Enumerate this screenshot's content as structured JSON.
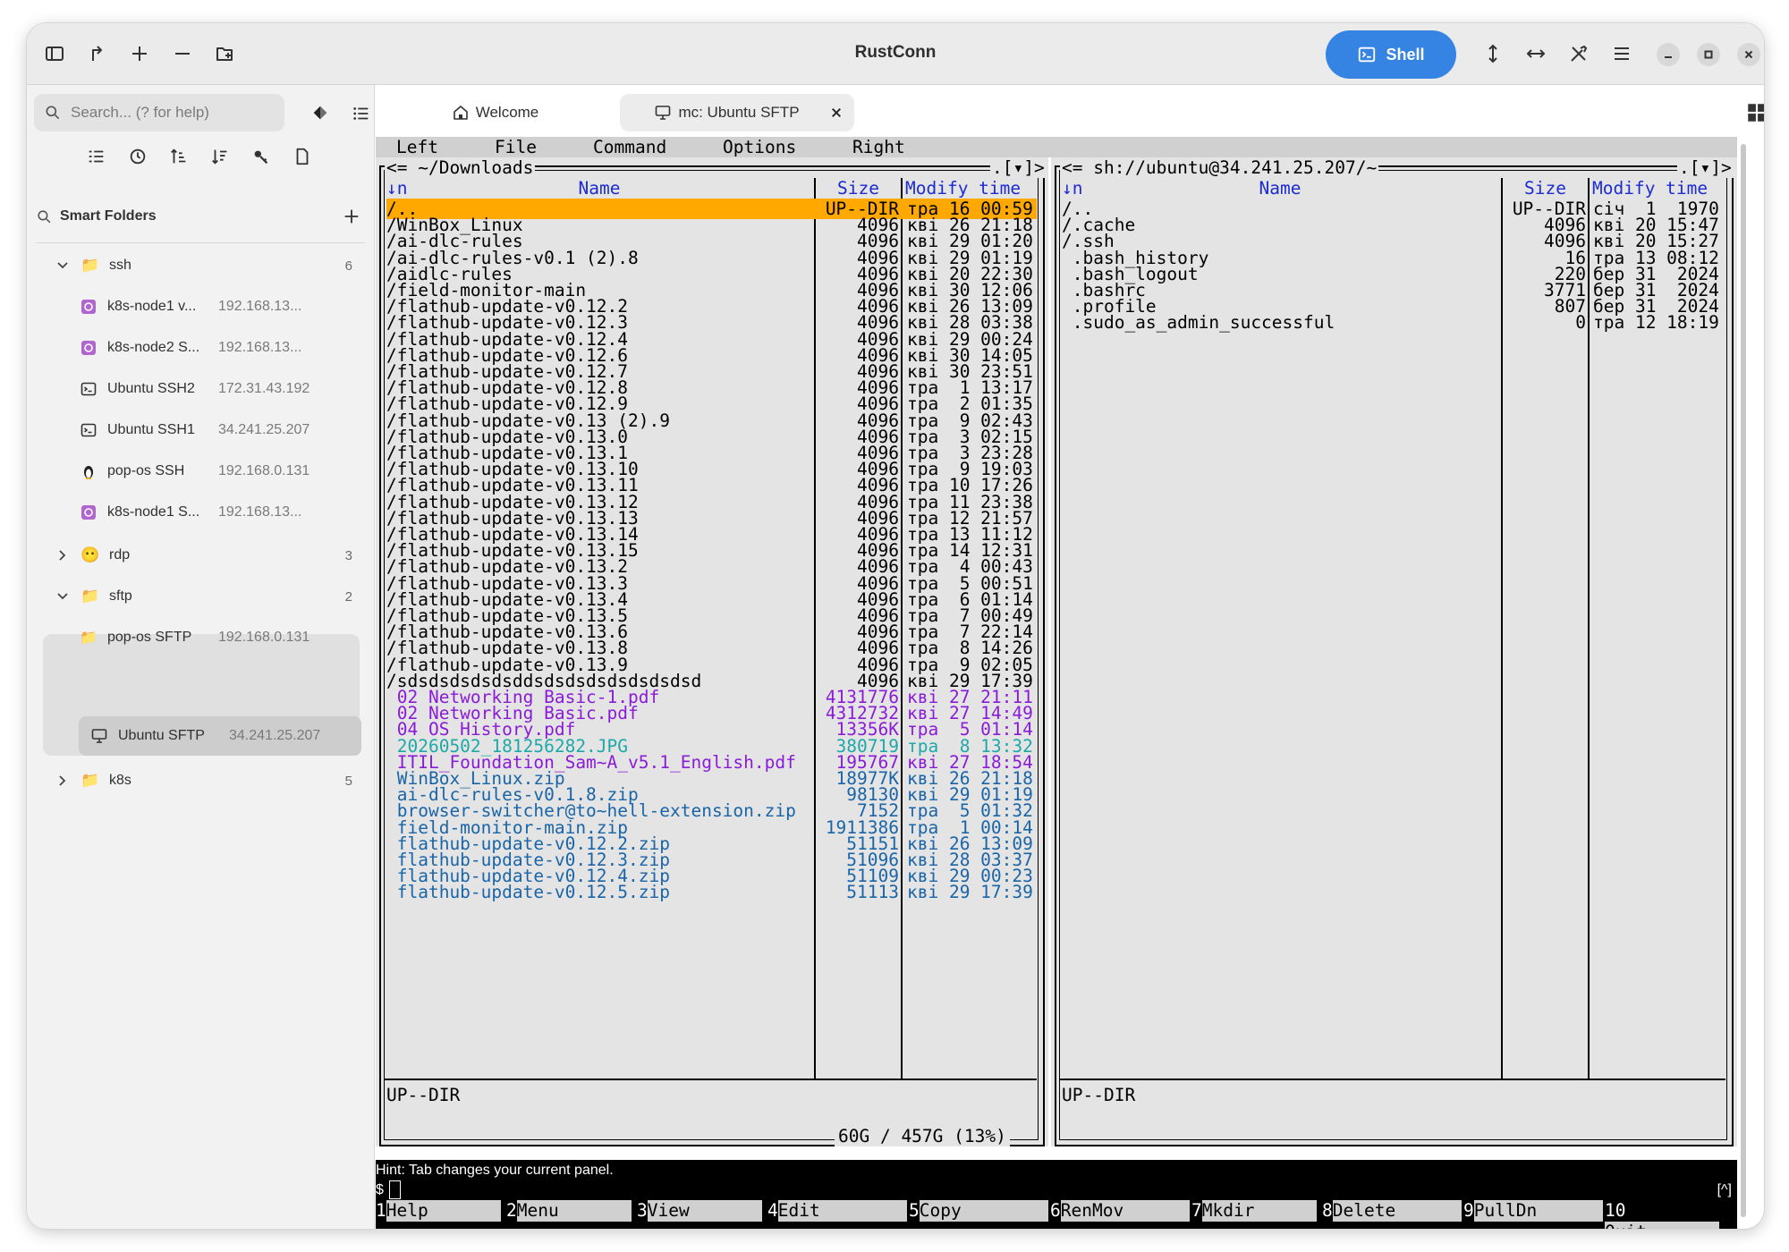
{
  "window": {
    "title": "RustConn"
  },
  "header": {
    "shell_label": "Shell"
  },
  "sidebar": {
    "search_placeholder": "Search... (? for help)",
    "smart_folders_label": "Smart Folders",
    "groups": [
      {
        "name": "ssh",
        "count": "6",
        "expanded": true,
        "items": [
          {
            "name": "k8s-node1 v...",
            "host": "192.168.13...",
            "icon": "k8s-icon"
          },
          {
            "name": "k8s-node2 S...",
            "host": "192.168.13...",
            "icon": "k8s-icon"
          },
          {
            "name": "Ubuntu SSH2",
            "host": "172.31.43.192",
            "icon": "terminal-icon"
          },
          {
            "name": "Ubuntu SSH1",
            "host": "34.241.25.207",
            "icon": "terminal-icon"
          },
          {
            "name": "pop-os SSH",
            "host": "192.168.0.131",
            "icon": "penguin-icon"
          },
          {
            "name": "k8s-node1 S...",
            "host": "192.168.13...",
            "icon": "k8s-icon"
          }
        ]
      },
      {
        "name": "rdp",
        "count": "3",
        "expanded": false,
        "items": []
      },
      {
        "name": "sftp",
        "count": "2",
        "expanded": true,
        "items": [
          {
            "name": "pop-os SFTP",
            "host": "192.168.0.131",
            "icon": "folder-icon"
          },
          {
            "name": "Ubuntu SFTP",
            "host": "34.241.25.207",
            "icon": "monitor-icon",
            "selected": true
          }
        ]
      },
      {
        "name": "k8s",
        "count": "5",
        "expanded": false,
        "items": []
      }
    ]
  },
  "tabs": [
    {
      "label": "Welcome",
      "icon": "home-icon"
    },
    {
      "label": "mc: Ubuntu SFTP",
      "icon": "monitor-icon",
      "active": true
    }
  ],
  "mc": {
    "menu": [
      "Left",
      "File",
      "Command",
      "Options",
      "Right"
    ],
    "left": {
      "path": "~/Downloads",
      "sort_marker": "↓n",
      "col_name": "Name",
      "col_size": "Size",
      "col_time": "Modify time",
      "status": "UP--DIR",
      "disk": "60G / 457G (13%)",
      "rows": [
        {
          "name": "/..",
          "size": "UP--DIR",
          "time": "тра 16 00:59",
          "type": "sel"
        },
        {
          "name": "/WinBox_Linux",
          "size": "4096",
          "time": "кві 26 21:18",
          "type": "dir"
        },
        {
          "name": "/ai-dlc-rules",
          "size": "4096",
          "time": "кві 29 01:20",
          "type": "dir"
        },
        {
          "name": "/ai-dlc-rules-v0.1 (2).8",
          "size": "4096",
          "time": "кві 29 01:19",
          "type": "dir"
        },
        {
          "name": "/aidlc-rules",
          "size": "4096",
          "time": "кві 20 22:30",
          "type": "dir"
        },
        {
          "name": "/field-monitor-main",
          "size": "4096",
          "time": "кві 30 12:06",
          "type": "dir"
        },
        {
          "name": "/flathub-update-v0.12.2",
          "size": "4096",
          "time": "кві 26 13:09",
          "type": "dir"
        },
        {
          "name": "/flathub-update-v0.12.3",
          "size": "4096",
          "time": "кві 28 03:38",
          "type": "dir"
        },
        {
          "name": "/flathub-update-v0.12.4",
          "size": "4096",
          "time": "кві 29 00:24",
          "type": "dir"
        },
        {
          "name": "/flathub-update-v0.12.6",
          "size": "4096",
          "time": "кві 30 14:05",
          "type": "dir"
        },
        {
          "name": "/flathub-update-v0.12.7",
          "size": "4096",
          "time": "кві 30 23:51",
          "type": "dir"
        },
        {
          "name": "/flathub-update-v0.12.8",
          "size": "4096",
          "time": "тра  1 13:17",
          "type": "dir"
        },
        {
          "name": "/flathub-update-v0.12.9",
          "size": "4096",
          "time": "тра  2 01:35",
          "type": "dir"
        },
        {
          "name": "/flathub-update-v0.13 (2).9",
          "size": "4096",
          "time": "тра  9 02:43",
          "type": "dir"
        },
        {
          "name": "/flathub-update-v0.13.0",
          "size": "4096",
          "time": "тра  3 02:15",
          "type": "dir"
        },
        {
          "name": "/flathub-update-v0.13.1",
          "size": "4096",
          "time": "тра  3 23:28",
          "type": "dir"
        },
        {
          "name": "/flathub-update-v0.13.10",
          "size": "4096",
          "time": "тра  9 19:03",
          "type": "dir"
        },
        {
          "name": "/flathub-update-v0.13.11",
          "size": "4096",
          "time": "тра 10 17:26",
          "type": "dir"
        },
        {
          "name": "/flathub-update-v0.13.12",
          "size": "4096",
          "time": "тра 11 23:38",
          "type": "dir"
        },
        {
          "name": "/flathub-update-v0.13.13",
          "size": "4096",
          "time": "тра 12 21:57",
          "type": "dir"
        },
        {
          "name": "/flathub-update-v0.13.14",
          "size": "4096",
          "time": "тра 13 11:12",
          "type": "dir"
        },
        {
          "name": "/flathub-update-v0.13.15",
          "size": "4096",
          "time": "тра 14 12:31",
          "type": "dir"
        },
        {
          "name": "/flathub-update-v0.13.2",
          "size": "4096",
          "time": "тра  4 00:43",
          "type": "dir"
        },
        {
          "name": "/flathub-update-v0.13.3",
          "size": "4096",
          "time": "тра  5 00:51",
          "type": "dir"
        },
        {
          "name": "/flathub-update-v0.13.4",
          "size": "4096",
          "time": "тра  6 01:14",
          "type": "dir"
        },
        {
          "name": "/flathub-update-v0.13.5",
          "size": "4096",
          "time": "тра  7 00:49",
          "type": "dir"
        },
        {
          "name": "/flathub-update-v0.13.6",
          "size": "4096",
          "time": "тра  7 22:14",
          "type": "dir"
        },
        {
          "name": "/flathub-update-v0.13.8",
          "size": "4096",
          "time": "тра  8 14:26",
          "type": "dir"
        },
        {
          "name": "/flathub-update-v0.13.9",
          "size": "4096",
          "time": "тра  9 02:05",
          "type": "dir"
        },
        {
          "name": "/sdsdsdsdsdsddsdsdsdsdsdsdsdsd",
          "size": "4096",
          "time": "кві 29 17:39",
          "type": "dir"
        },
        {
          "name": " 02 Networking Basic-1.pdf",
          "size": "4131776",
          "time": "кві 27 21:11",
          "type": "doc"
        },
        {
          "name": " 02 Networking Basic.pdf",
          "size": "4312732",
          "time": "кві 27 14:49",
          "type": "doc"
        },
        {
          "name": " 04 OS History.pdf",
          "size": "13356K",
          "time": "тра  5 01:14",
          "type": "doc"
        },
        {
          "name": " 20260502_181256282.JPG",
          "size": "380719",
          "time": "тра  8 13:32",
          "type": "img"
        },
        {
          "name": " ITIL_Foundation_Sam~A_v5.1_English.pdf",
          "size": "195767",
          "time": "кві 27 18:54",
          "type": "doc"
        },
        {
          "name": " WinBox_Linux.zip",
          "size": "18977K",
          "time": "кві 26 21:18",
          "type": "arc"
        },
        {
          "name": " ai-dlc-rules-v0.1.8.zip",
          "size": "98130",
          "time": "кві 29 01:19",
          "type": "arc"
        },
        {
          "name": " browser-switcher@to~hell-extension.zip",
          "size": "7152",
          "time": "тра  5 01:32",
          "type": "arc"
        },
        {
          "name": " field-monitor-main.zip",
          "size": "1911386",
          "time": "тра  1 00:14",
          "type": "arc"
        },
        {
          "name": " flathub-update-v0.12.2.zip",
          "size": "51151",
          "time": "кві 26 13:09",
          "type": "arc"
        },
        {
          "name": " flathub-update-v0.12.3.zip",
          "size": "51096",
          "time": "кві 28 03:37",
          "type": "arc"
        },
        {
          "name": " flathub-update-v0.12.4.zip",
          "size": "51109",
          "time": "кві 29 00:23",
          "type": "arc"
        },
        {
          "name": " flathub-update-v0.12.5.zip",
          "size": "51113",
          "time": "кві 29 17:39",
          "type": "arc"
        }
      ]
    },
    "right": {
      "path": "sh://ubuntu@34.241.25.207/~",
      "sort_marker": "↓n",
      "col_name": "Name",
      "col_size": "Size",
      "col_time": "Modify time",
      "status": "UP--DIR",
      "rows": [
        {
          "name": "/..",
          "size": "UP--DIR",
          "time": "січ  1  1970",
          "type": "dir"
        },
        {
          "name": "/.cache",
          "size": "4096",
          "time": "кві 20 15:47",
          "type": "dir"
        },
        {
          "name": "/.ssh",
          "size": "4096",
          "time": "кві 20 15:27",
          "type": "dir"
        },
        {
          "name": " .bash_history",
          "size": "16",
          "time": "тра 13 08:12",
          "type": "dir"
        },
        {
          "name": " .bash_logout",
          "size": "220",
          "time": "бер 31  2024",
          "type": "dir"
        },
        {
          "name": " .bashrc",
          "size": "3771",
          "time": "бер 31  2024",
          "type": "dir"
        },
        {
          "name": " .profile",
          "size": "807",
          "time": "бер 31  2024",
          "type": "dir"
        },
        {
          "name": " .sudo_as_admin_successful",
          "size": "0",
          "time": "тра 12 18:19",
          "type": "dir"
        }
      ]
    },
    "hint": "Hint: Tab changes your current panel.",
    "prompt": "$",
    "bracket": "[^]",
    "fkeys": [
      {
        "num": "1",
        "label": "Help"
      },
      {
        "num": "2",
        "label": "Menu"
      },
      {
        "num": "3",
        "label": "View"
      },
      {
        "num": "4",
        "label": "Edit"
      },
      {
        "num": "5",
        "label": "Copy"
      },
      {
        "num": "6",
        "label": "RenMov"
      },
      {
        "num": "7",
        "label": "Mkdir"
      },
      {
        "num": "8",
        "label": "Delete"
      },
      {
        "num": "9",
        "label": "PullDn"
      },
      {
        "num": "10",
        "label": "Quit"
      }
    ]
  }
}
